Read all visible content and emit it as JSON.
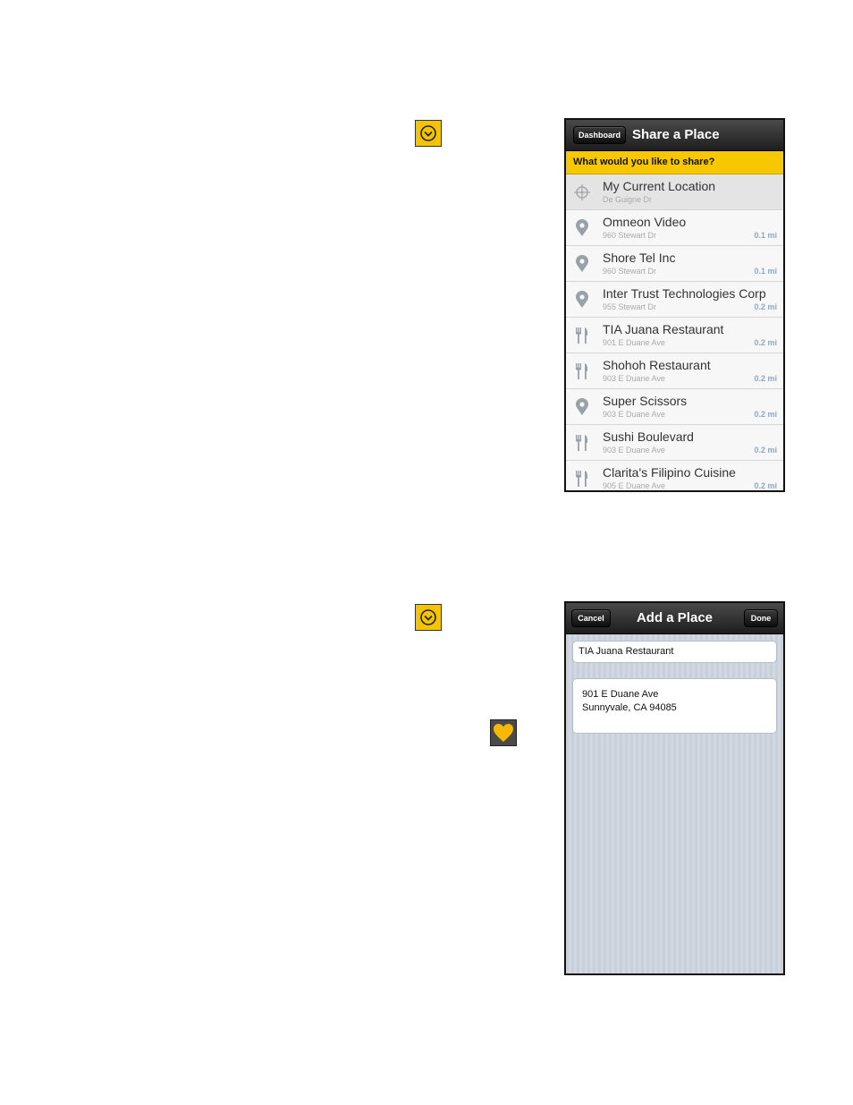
{
  "share_screen": {
    "back_button": "Dashboard",
    "title": "Share a Place",
    "prompt": "What would you like to share?",
    "items": [
      {
        "name": "My Current Location",
        "address": "De Guigne Dr",
        "distance": "",
        "icon": "crosshair-icon"
      },
      {
        "name": "Omneon Video",
        "address": "960 Stewart Dr",
        "distance": "0.1 mi",
        "icon": "pin-icon"
      },
      {
        "name": "Shore Tel Inc",
        "address": "960 Stewart Dr",
        "distance": "0.1 mi",
        "icon": "pin-icon"
      },
      {
        "name": "Inter Trust Technologies Corp",
        "address": "955 Stewart Dr",
        "distance": "0.2 mi",
        "icon": "pin-icon"
      },
      {
        "name": "TIA Juana Restaurant",
        "address": "901 E Duane Ave",
        "distance": "0.2 mi",
        "icon": "fork-knife-icon"
      },
      {
        "name": "Shohoh Restaurant",
        "address": "903 E Duane Ave",
        "distance": "0.2 mi",
        "icon": "fork-knife-icon"
      },
      {
        "name": "Super Scissors",
        "address": "903 E Duane Ave",
        "distance": "0.2 mi",
        "icon": "pin-icon"
      },
      {
        "name": "Sushi Boulevard",
        "address": "903 E Duane Ave",
        "distance": "0.2 mi",
        "icon": "fork-knife-icon"
      },
      {
        "name": "Clarita's Filipino Cuisine",
        "address": "905 E Duane Ave",
        "distance": "0.2 mi",
        "icon": "fork-knife-icon"
      }
    ]
  },
  "add_screen": {
    "cancel_button": "Cancel",
    "title": "Add a Place",
    "done_button": "Done",
    "name_value": "TIA Juana Restaurant",
    "address_line1": "901 E Duane Ave",
    "address_line2": "Sunnyvale, CA 94085"
  },
  "colors": {
    "accent_yellow": "#f7c800",
    "distance_blue": "#8aa8c8"
  }
}
